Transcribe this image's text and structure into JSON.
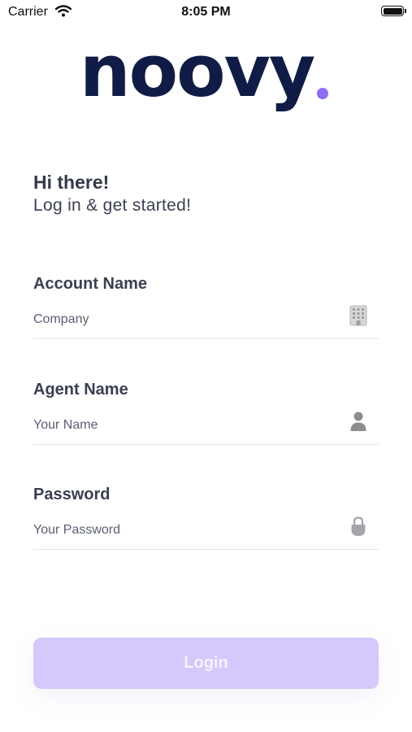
{
  "status_bar": {
    "carrier": "Carrier",
    "time": "8:05 PM"
  },
  "brand": {
    "logo_text": "noovy",
    "accent_color": "#8f6cf2",
    "text_color": "#101c45"
  },
  "greeting": {
    "title": "Hi there!",
    "subtitle": "Log in & get started!"
  },
  "form": {
    "account": {
      "label": "Account Name",
      "placeholder": "Company",
      "value": "",
      "icon": "building-icon"
    },
    "agent": {
      "label": "Agent Name",
      "placeholder": "Your Name",
      "value": "",
      "icon": "person-icon"
    },
    "password": {
      "label": "Password",
      "placeholder": "Your Password",
      "value": "",
      "icon": "lock-icon"
    }
  },
  "login_button": {
    "label": "Login",
    "color": "#d5c8fb",
    "enabled": false
  }
}
